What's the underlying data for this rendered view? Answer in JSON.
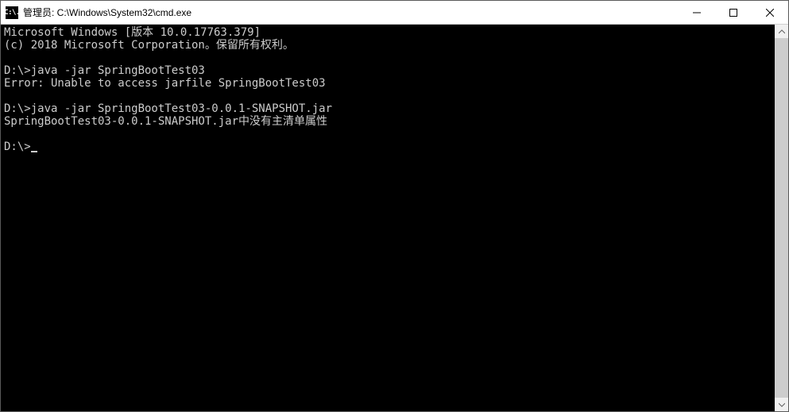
{
  "titlebar": {
    "icon_text": "C:\\.",
    "title": "管理员: C:\\Windows\\System32\\cmd.exe"
  },
  "console": {
    "lines": [
      "Microsoft Windows [版本 10.0.17763.379]",
      "(c) 2018 Microsoft Corporation。保留所有权利。",
      "",
      "D:\\>java -jar SpringBootTest03",
      "Error: Unable to access jarfile SpringBootTest03",
      "",
      "D:\\>java -jar SpringBootTest03-0.0.1-SNAPSHOT.jar",
      "SpringBootTest03-0.0.1-SNAPSHOT.jar中没有主清单属性",
      ""
    ],
    "prompt": "D:\\>"
  }
}
